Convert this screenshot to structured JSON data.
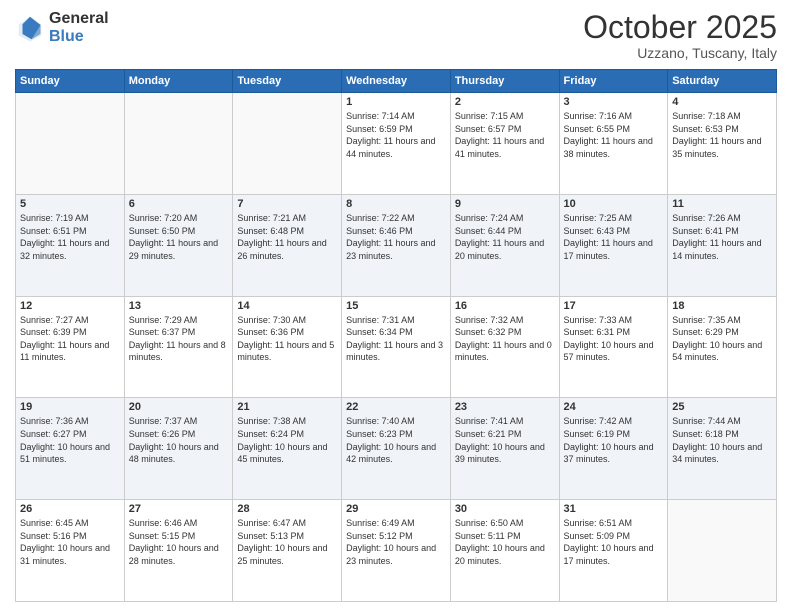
{
  "header": {
    "logo_general": "General",
    "logo_blue": "Blue",
    "title": "October 2025",
    "location": "Uzzano, Tuscany, Italy"
  },
  "days_of_week": [
    "Sunday",
    "Monday",
    "Tuesday",
    "Wednesday",
    "Thursday",
    "Friday",
    "Saturday"
  ],
  "weeks": [
    [
      {
        "day": "",
        "info": ""
      },
      {
        "day": "",
        "info": ""
      },
      {
        "day": "",
        "info": ""
      },
      {
        "day": "1",
        "info": "Sunrise: 7:14 AM\nSunset: 6:59 PM\nDaylight: 11 hours and 44 minutes."
      },
      {
        "day": "2",
        "info": "Sunrise: 7:15 AM\nSunset: 6:57 PM\nDaylight: 11 hours and 41 minutes."
      },
      {
        "day": "3",
        "info": "Sunrise: 7:16 AM\nSunset: 6:55 PM\nDaylight: 11 hours and 38 minutes."
      },
      {
        "day": "4",
        "info": "Sunrise: 7:18 AM\nSunset: 6:53 PM\nDaylight: 11 hours and 35 minutes."
      }
    ],
    [
      {
        "day": "5",
        "info": "Sunrise: 7:19 AM\nSunset: 6:51 PM\nDaylight: 11 hours and 32 minutes."
      },
      {
        "day": "6",
        "info": "Sunrise: 7:20 AM\nSunset: 6:50 PM\nDaylight: 11 hours and 29 minutes."
      },
      {
        "day": "7",
        "info": "Sunrise: 7:21 AM\nSunset: 6:48 PM\nDaylight: 11 hours and 26 minutes."
      },
      {
        "day": "8",
        "info": "Sunrise: 7:22 AM\nSunset: 6:46 PM\nDaylight: 11 hours and 23 minutes."
      },
      {
        "day": "9",
        "info": "Sunrise: 7:24 AM\nSunset: 6:44 PM\nDaylight: 11 hours and 20 minutes."
      },
      {
        "day": "10",
        "info": "Sunrise: 7:25 AM\nSunset: 6:43 PM\nDaylight: 11 hours and 17 minutes."
      },
      {
        "day": "11",
        "info": "Sunrise: 7:26 AM\nSunset: 6:41 PM\nDaylight: 11 hours and 14 minutes."
      }
    ],
    [
      {
        "day": "12",
        "info": "Sunrise: 7:27 AM\nSunset: 6:39 PM\nDaylight: 11 hours and 11 minutes."
      },
      {
        "day": "13",
        "info": "Sunrise: 7:29 AM\nSunset: 6:37 PM\nDaylight: 11 hours and 8 minutes."
      },
      {
        "day": "14",
        "info": "Sunrise: 7:30 AM\nSunset: 6:36 PM\nDaylight: 11 hours and 5 minutes."
      },
      {
        "day": "15",
        "info": "Sunrise: 7:31 AM\nSunset: 6:34 PM\nDaylight: 11 hours and 3 minutes."
      },
      {
        "day": "16",
        "info": "Sunrise: 7:32 AM\nSunset: 6:32 PM\nDaylight: 11 hours and 0 minutes."
      },
      {
        "day": "17",
        "info": "Sunrise: 7:33 AM\nSunset: 6:31 PM\nDaylight: 10 hours and 57 minutes."
      },
      {
        "day": "18",
        "info": "Sunrise: 7:35 AM\nSunset: 6:29 PM\nDaylight: 10 hours and 54 minutes."
      }
    ],
    [
      {
        "day": "19",
        "info": "Sunrise: 7:36 AM\nSunset: 6:27 PM\nDaylight: 10 hours and 51 minutes."
      },
      {
        "day": "20",
        "info": "Sunrise: 7:37 AM\nSunset: 6:26 PM\nDaylight: 10 hours and 48 minutes."
      },
      {
        "day": "21",
        "info": "Sunrise: 7:38 AM\nSunset: 6:24 PM\nDaylight: 10 hours and 45 minutes."
      },
      {
        "day": "22",
        "info": "Sunrise: 7:40 AM\nSunset: 6:23 PM\nDaylight: 10 hours and 42 minutes."
      },
      {
        "day": "23",
        "info": "Sunrise: 7:41 AM\nSunset: 6:21 PM\nDaylight: 10 hours and 39 minutes."
      },
      {
        "day": "24",
        "info": "Sunrise: 7:42 AM\nSunset: 6:19 PM\nDaylight: 10 hours and 37 minutes."
      },
      {
        "day": "25",
        "info": "Sunrise: 7:44 AM\nSunset: 6:18 PM\nDaylight: 10 hours and 34 minutes."
      }
    ],
    [
      {
        "day": "26",
        "info": "Sunrise: 6:45 AM\nSunset: 5:16 PM\nDaylight: 10 hours and 31 minutes."
      },
      {
        "day": "27",
        "info": "Sunrise: 6:46 AM\nSunset: 5:15 PM\nDaylight: 10 hours and 28 minutes."
      },
      {
        "day": "28",
        "info": "Sunrise: 6:47 AM\nSunset: 5:13 PM\nDaylight: 10 hours and 25 minutes."
      },
      {
        "day": "29",
        "info": "Sunrise: 6:49 AM\nSunset: 5:12 PM\nDaylight: 10 hours and 23 minutes."
      },
      {
        "day": "30",
        "info": "Sunrise: 6:50 AM\nSunset: 5:11 PM\nDaylight: 10 hours and 20 minutes."
      },
      {
        "day": "31",
        "info": "Sunrise: 6:51 AM\nSunset: 5:09 PM\nDaylight: 10 hours and 17 minutes."
      },
      {
        "day": "",
        "info": ""
      }
    ]
  ]
}
